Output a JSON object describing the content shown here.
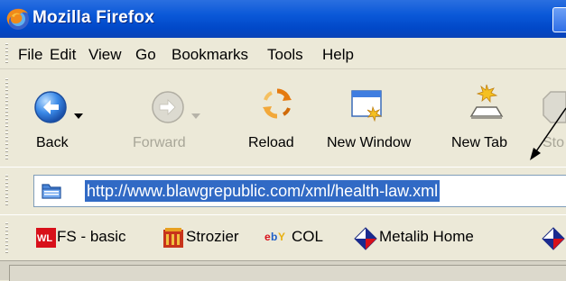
{
  "window": {
    "title": "Mozilla Firefox"
  },
  "menubar": {
    "items": [
      {
        "label": "File"
      },
      {
        "label": "Edit"
      },
      {
        "label": "View"
      },
      {
        "label": "Go"
      },
      {
        "label": "Bookmarks"
      },
      {
        "label": "Tools"
      },
      {
        "label": "Help"
      }
    ]
  },
  "toolbar": {
    "back_label": "Back",
    "forward_label": "Forward",
    "reload_label": "Reload",
    "new_window_label": "New Window",
    "new_tab_label": "New Tab",
    "stop_label_partial": "Sto",
    "forward_enabled": false,
    "stop_enabled": false
  },
  "urlbar": {
    "url": "http://www.blawgrepublic.com/xml/health-law.xml",
    "selected": true,
    "selection_color": "#316ac5"
  },
  "bookmarks": {
    "items": [
      {
        "label": "FS - basic",
        "icon": "wl-logo-icon"
      },
      {
        "label": "Strozier",
        "icon": "library-icon"
      },
      {
        "label": "COL",
        "icon": "ebay-icon"
      },
      {
        "label": "Metalib Home",
        "icon": "metalib-icon"
      }
    ]
  },
  "colors": {
    "titlebar": "#0a58d8",
    "chrome": "#ece9d8",
    "highlight": "#316ac5"
  }
}
